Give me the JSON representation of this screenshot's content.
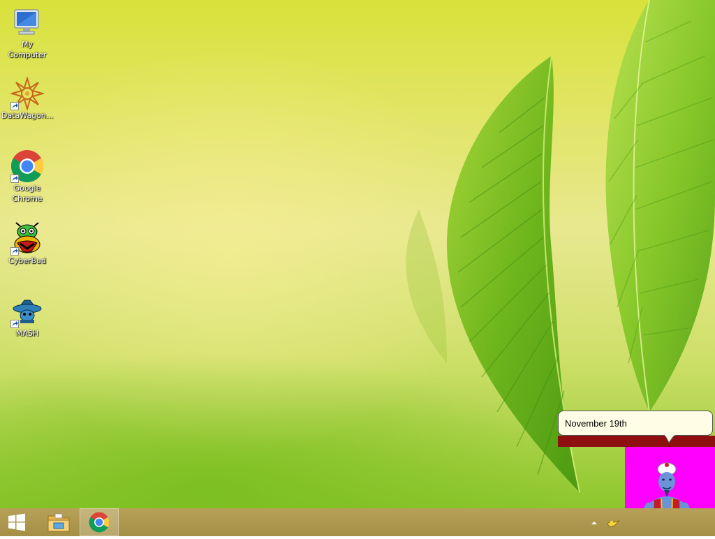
{
  "desktop": {
    "icons": [
      {
        "label": "My Computer",
        "icon": "computer-icon"
      },
      {
        "label": "DataWagon...",
        "icon": "datawagon-icon"
      },
      {
        "label": "Google Chrome",
        "icon": "chrome-icon"
      },
      {
        "label": "CyberBud",
        "icon": "cyberbud-icon"
      },
      {
        "label": "MASH",
        "icon": "mash-icon"
      }
    ]
  },
  "taskbar": {
    "start": "windows-logo-icon",
    "pinned": [
      "file-explorer-icon",
      "chrome-icon"
    ],
    "tray": [
      "show-hidden-icons-icon",
      "genie-lamp-icon"
    ]
  },
  "assistant": {
    "balloon_text": "November 19th",
    "panel_color": "#ff00ff"
  }
}
